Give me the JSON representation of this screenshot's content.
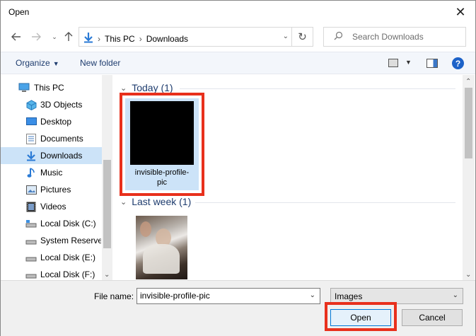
{
  "window": {
    "title": "Open",
    "close_glyph": "✕"
  },
  "nav": {
    "back_icon": "back-arrow-icon",
    "forward_icon": "forward-arrow-icon",
    "up_icon": "up-arrow-icon",
    "breadcrumbs": [
      "This PC",
      "Downloads"
    ],
    "search_placeholder": "Search Downloads"
  },
  "toolbar": {
    "organize_label": "Organize",
    "new_folder_label": "New folder",
    "help_label": "?"
  },
  "sidebar": {
    "items": [
      {
        "label": "This PC",
        "icon": "computer-icon",
        "selected": false
      },
      {
        "label": "3D Objects",
        "icon": "cube-icon",
        "selected": false
      },
      {
        "label": "Desktop",
        "icon": "desktop-icon",
        "selected": false
      },
      {
        "label": "Documents",
        "icon": "document-icon",
        "selected": false
      },
      {
        "label": "Downloads",
        "icon": "download-icon",
        "selected": true
      },
      {
        "label": "Music",
        "icon": "music-icon",
        "selected": false
      },
      {
        "label": "Pictures",
        "icon": "pictures-icon",
        "selected": false
      },
      {
        "label": "Videos",
        "icon": "video-icon",
        "selected": false
      },
      {
        "label": "Local Disk (C:)",
        "icon": "drive-icon",
        "selected": false
      },
      {
        "label": "System Reserved",
        "icon": "drive-icon",
        "selected": false
      },
      {
        "label": "Local Disk (E:)",
        "icon": "drive-icon",
        "selected": false
      },
      {
        "label": "Local Disk (F:)",
        "icon": "drive-icon",
        "selected": false
      }
    ]
  },
  "files": {
    "groups": [
      {
        "header": "Today (1)",
        "items": [
          {
            "name_line1": "invisible-profile-",
            "name_line2": "pic",
            "selected": true
          }
        ]
      },
      {
        "header": "Last week (1)",
        "items": [
          {
            "name_line1": "",
            "name_line2": "",
            "selected": false
          }
        ]
      }
    ]
  },
  "footer": {
    "file_name_label": "File name:",
    "file_name_value": "invisible-profile-pic",
    "file_type_value": "Images",
    "open_label": "Open",
    "cancel_label": "Cancel"
  },
  "colors": {
    "accent": "#0078d7",
    "selection": "#cce3f8",
    "highlight_box": "#e8301c",
    "link": "#1e3c6e"
  }
}
